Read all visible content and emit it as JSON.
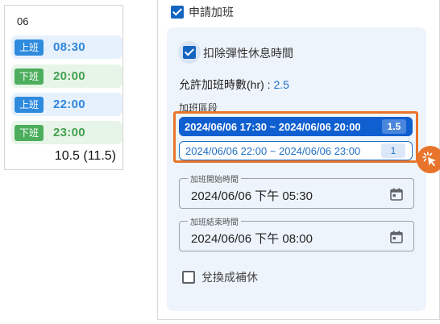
{
  "attendance": {
    "date": "06",
    "rows": [
      {
        "badge": "上班",
        "time": "08:30",
        "kind": "in"
      },
      {
        "badge": "下班",
        "time": "20:00",
        "kind": "out"
      },
      {
        "badge": "上班",
        "time": "22:00",
        "kind": "in"
      },
      {
        "badge": "下班",
        "time": "23:00",
        "kind": "out"
      }
    ],
    "total": "10.5 (11.5)"
  },
  "form": {
    "apply_overtime_label": "申請加班",
    "apply_overtime_checked": true,
    "deduct_flex_label": "扣除彈性休息時間",
    "deduct_flex_checked": true,
    "allowed_hours_label": "允許加班時數(hr) :",
    "allowed_hours_value": "2.5",
    "segments_title": "加班區段",
    "segments": [
      {
        "range": "2024/06/06 17:30 ~ 2024/06/06 20:00",
        "hours": "1.5",
        "selected": true
      },
      {
        "range": "2024/06/06 22:00 ~ 2024/06/06 23:00",
        "hours": "1",
        "selected": false
      }
    ],
    "start_field": {
      "label": "加班開始時間",
      "value": "2024/06/06 下午 05:30"
    },
    "end_field": {
      "label": "加班結束時間",
      "value": "2024/06/06 下午 08:00"
    },
    "compensatory_label": "兌換成補休",
    "compensatory_checked": false
  },
  "colors": {
    "accent": "#1565c0",
    "highlight": "#e8742c",
    "in_badge": "#2f8bde",
    "out_badge": "#4cae5c"
  },
  "icons": {
    "calendar": "calendar-icon",
    "click": "click-cursor-icon"
  }
}
